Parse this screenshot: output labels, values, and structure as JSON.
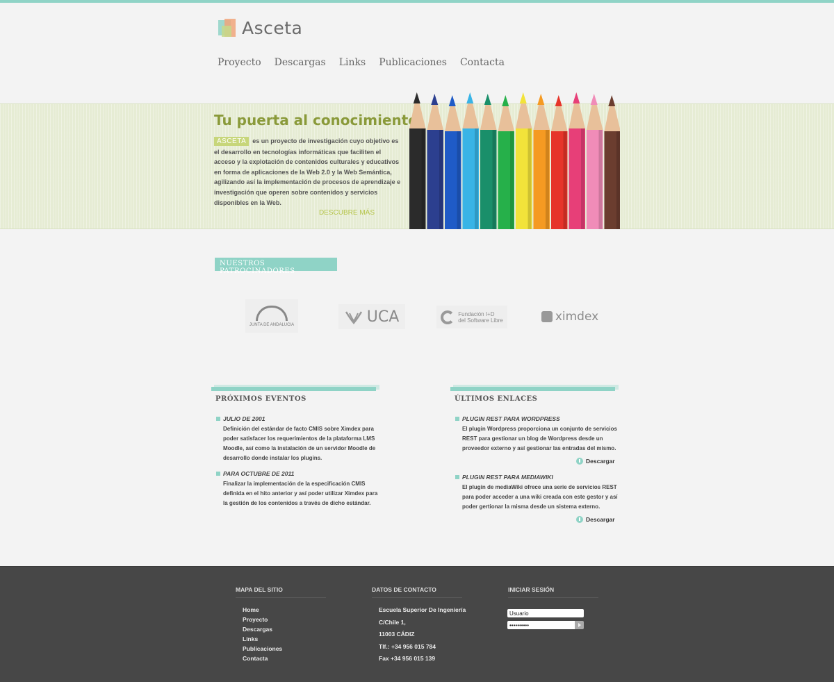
{
  "site": {
    "name": "Asceta"
  },
  "nav": {
    "items": [
      "Proyecto",
      "Descargas",
      "Links",
      "Publicaciones",
      "Contacta"
    ]
  },
  "hero": {
    "title": "Tu puerta al conocimiento",
    "tag": "ASCETA",
    "text": "es un proyecto de investigación cuyo objetivo es el desarrollo en tecnologías informáticas que faciliten el acceso y la explotación de contenidos culturales y educativos en forma de aplicaciones de la Web 2.0 y la Web Semántica, agilizando así la implementación de procesos de aprendizaje e investigación que operen sobre contenidos y servicios disponibles en la Web.",
    "more_label": "DESCUBRE MÁS",
    "pencil_colors": [
      "#2b2b2b",
      "#2c3f8f",
      "#1f5bc7",
      "#39b4e6",
      "#1a8f6a",
      "#26b04a",
      "#f2e33a",
      "#f59a22",
      "#e6342a",
      "#e73f78",
      "#f08cb8",
      "#6b3d2f"
    ]
  },
  "sponsors": {
    "label": "NUESTROS PATROCINADORES",
    "junta": "JUNTA DE ANDALUCIA",
    "uca": "UCA",
    "fundacion": [
      "Fundación I+D",
      "del Software Libre"
    ],
    "ximdex": "ximdex"
  },
  "events": {
    "title": "PRÓXIMOS EVENTOS",
    "items": [
      {
        "title": "JULIO DE 2001",
        "body": "Definición del estándar de facto CMIS sobre Ximdex para poder satisfacer los requerimientos de la plataforma LMS Moodle, así como la instalación de un servidor Moodle de desarrollo donde instalar los plugins."
      },
      {
        "title": "PARA OCTUBRE DE 2011",
        "body": "Finalizar la implementación de la especificación CMIS definida en el hito anterior y así poder utilizar Ximdex para la gestión de los contenidos a través de dicho estándar."
      }
    ]
  },
  "links": {
    "title": "ÚLTIMOS ENLACES",
    "items": [
      {
        "title": "PLUGIN REST PARA WORDPRESS",
        "body": "El plugin Wordpress proporciona un conjunto de servicios REST para gestionar un blog de Wordpress desde un proveedor externo y así gestionar las entradas del mismo.",
        "download": "Descargar"
      },
      {
        "title": "PLUGIN REST PARA MEDIAWIKI",
        "body": "El plugin de mediaWiki ofrece una serie de servicios REST para poder acceder a una wiki creada con este gestor y así poder gertionar la misma desde un sistema externo.",
        "download": "Descargar"
      }
    ]
  },
  "footer": {
    "sitemap": {
      "title": "MAPA DEL SITIO",
      "items": [
        "Home",
        "Proyecto",
        "Descargas",
        "Links",
        "Publicaciones",
        "Contacta"
      ]
    },
    "contact": {
      "title": "DATOS DE CONTACTO",
      "lines": [
        "Escuela Superior De Ingeniería",
        "C/Chile 1,",
        "11003 CÁDIZ",
        "Tlf.: +34 956 015 784",
        "Fax +34 956 015 139"
      ]
    },
    "login": {
      "title": "INICIAR SESIÓN",
      "user_value": "Usuario",
      "password_value": "••••••••••"
    }
  }
}
